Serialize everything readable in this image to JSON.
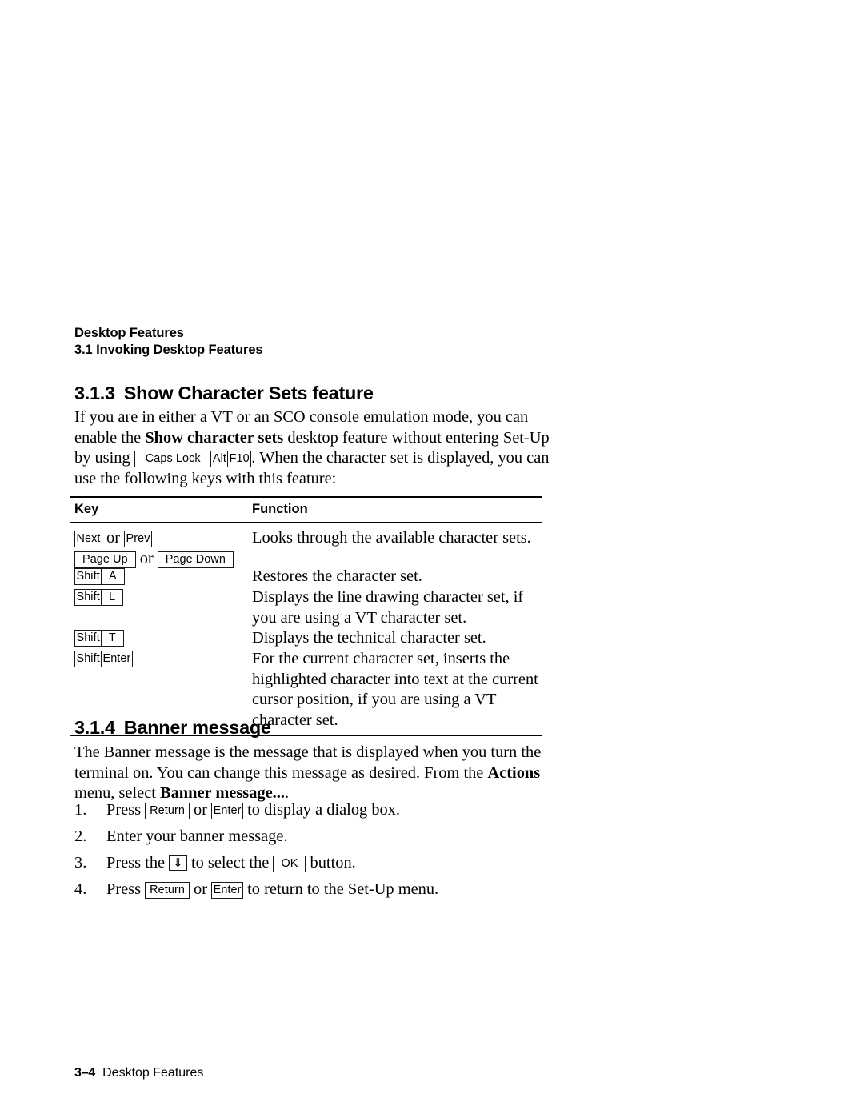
{
  "running_head": {
    "line1": "Desktop Features",
    "line2": "3.1 Invoking Desktop Features"
  },
  "sections": {
    "show_char_sets": {
      "number": "3.1.3",
      "title": "Show Character Sets feature",
      "paragraph": {
        "part1": "If you are in either a VT or an SCO console emulation mode, you can enable the ",
        "bold1": "Show character sets",
        "part2": " desktop feature without entering Set-Up by using ",
        "keys": [
          "Caps Lock",
          "Alt",
          "F10"
        ],
        "part3": ". When the character set is displayed, you can use the following keys with this feature:"
      }
    },
    "banner_message": {
      "number": "3.1.4",
      "title": "Banner message",
      "paragraph": {
        "part1": "The Banner message is the message that is displayed when you turn the terminal on. You can change this message as desired. From the ",
        "bold1": "Actions",
        "part2": " menu, select ",
        "bold2": "Banner message...",
        "part3": "."
      }
    }
  },
  "key_table": {
    "headers": {
      "key": "Key",
      "function": "Function"
    },
    "rows": [
      {
        "keys_line1": [
          "Next",
          "Prev"
        ],
        "keys_line1_sep": "or",
        "keys_line2": [
          "Page Up",
          "Page Down"
        ],
        "keys_line2_sep": "or",
        "function": "Looks through the available character sets."
      },
      {
        "keys_combo": [
          "Shift",
          "A"
        ],
        "function": "Restores the character set."
      },
      {
        "keys_combo": [
          "Shift",
          "L"
        ],
        "function": "Displays the line drawing character set, if you are using a VT character set."
      },
      {
        "keys_combo": [
          "Shift",
          "T"
        ],
        "function": "Displays the technical character set."
      },
      {
        "keys_combo": [
          "Shift",
          "Enter"
        ],
        "function": "For the current character set, inserts the highlighted character into text at the current cursor position, if you are using a VT character set."
      }
    ]
  },
  "steps": [
    {
      "number": "1.",
      "t1": "Press ",
      "key1": "Return",
      "t2": " or ",
      "key2": "Enter",
      "t3": " to display a dialog box."
    },
    {
      "number": "2.",
      "t1": "Enter your banner message.",
      "key1": "",
      "t2": "",
      "key2": "",
      "t3": ""
    },
    {
      "number": "3.",
      "t1": "Press the ",
      "key1": "⇓",
      "t2": " to select the ",
      "key2": "OK",
      "t3": " button."
    },
    {
      "number": "4.",
      "t1": "Press ",
      "key1": "Return",
      "t2": " or ",
      "key2": "Enter",
      "t3": " to return to the Set-Up menu."
    }
  ],
  "footer": {
    "page_number": "3–4",
    "chapter_title": "Desktop Features"
  }
}
